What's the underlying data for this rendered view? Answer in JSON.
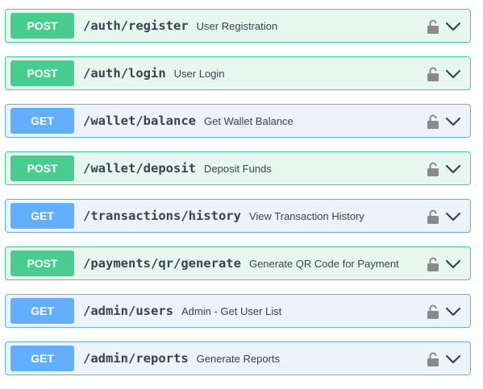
{
  "operations": [
    {
      "method": "POST",
      "path": "/auth/register",
      "summary": "User Registration",
      "lock_icon": "lock-icon",
      "toggle_icon": "chevron-down-icon"
    },
    {
      "method": "POST",
      "path": "/auth/login",
      "summary": "User Login",
      "lock_icon": "lock-icon",
      "toggle_icon": "chevron-down-icon"
    },
    {
      "method": "GET",
      "path": "/wallet/balance",
      "summary": "Get Wallet Balance",
      "lock_icon": "lock-icon",
      "toggle_icon": "chevron-down-icon"
    },
    {
      "method": "POST",
      "path": "/wallet/deposit",
      "summary": "Deposit Funds",
      "lock_icon": "lock-icon",
      "toggle_icon": "chevron-down-icon"
    },
    {
      "method": "GET",
      "path": "/transactions/history",
      "summary": "View Transaction History",
      "lock_icon": "lock-icon",
      "toggle_icon": "chevron-down-icon"
    },
    {
      "method": "POST",
      "path": "/payments/qr/generate",
      "summary": "Generate QR Code for Payment",
      "lock_icon": "lock-icon",
      "toggle_icon": "chevron-down-icon"
    },
    {
      "method": "GET",
      "path": "/admin/users",
      "summary": "Admin - Get User List",
      "lock_icon": "lock-icon",
      "toggle_icon": "chevron-down-icon"
    },
    {
      "method": "GET",
      "path": "/admin/reports",
      "summary": "Generate Reports",
      "lock_icon": "lock-icon",
      "toggle_icon": "chevron-down-icon"
    }
  ],
  "colors": {
    "post_accent": "#49cc90",
    "post_background": "#e8f6f0",
    "get_accent": "#61affe",
    "get_background": "#ebf3fb",
    "text": "#3b4151",
    "lock_icon": "#8a8a8a"
  }
}
